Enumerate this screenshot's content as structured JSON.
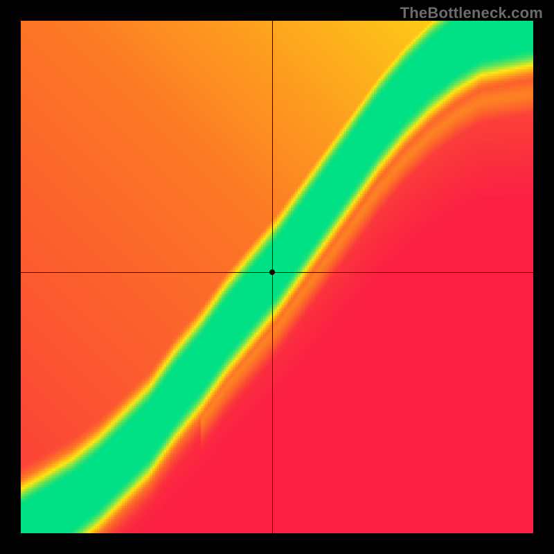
{
  "watermark": "TheBottleneck.com",
  "chart_data": {
    "type": "heatmap",
    "title": "",
    "xlabel": "",
    "ylabel": "",
    "xlim": [
      0,
      100
    ],
    "ylim": [
      0,
      100
    ],
    "grid": false,
    "legend": "none",
    "crosshair": {
      "x": 49,
      "y": 51
    },
    "ridge_curve": [
      [
        0,
        0
      ],
      [
        5,
        3
      ],
      [
        10,
        6
      ],
      [
        15,
        10
      ],
      [
        20,
        15
      ],
      [
        25,
        20
      ],
      [
        30,
        27
      ],
      [
        35,
        33
      ],
      [
        40,
        40
      ],
      [
        45,
        46
      ],
      [
        50,
        52
      ],
      [
        55,
        59
      ],
      [
        60,
        66
      ],
      [
        65,
        73
      ],
      [
        70,
        80
      ],
      [
        75,
        86
      ],
      [
        80,
        91
      ],
      [
        85,
        95
      ],
      [
        90,
        98
      ],
      [
        95,
        99
      ],
      [
        100,
        100
      ]
    ],
    "ridge_half_width": 5,
    "corner_field": {
      "top_left": "low",
      "bottom_left": "low",
      "bottom_right": "low",
      "top_right": "mid",
      "along_ridge": "high"
    },
    "palette": {
      "low": "#fb1f44",
      "mid_low": "#fd7a25",
      "mid": "#fee813",
      "high": "#00e085"
    },
    "resolution": 222
  }
}
